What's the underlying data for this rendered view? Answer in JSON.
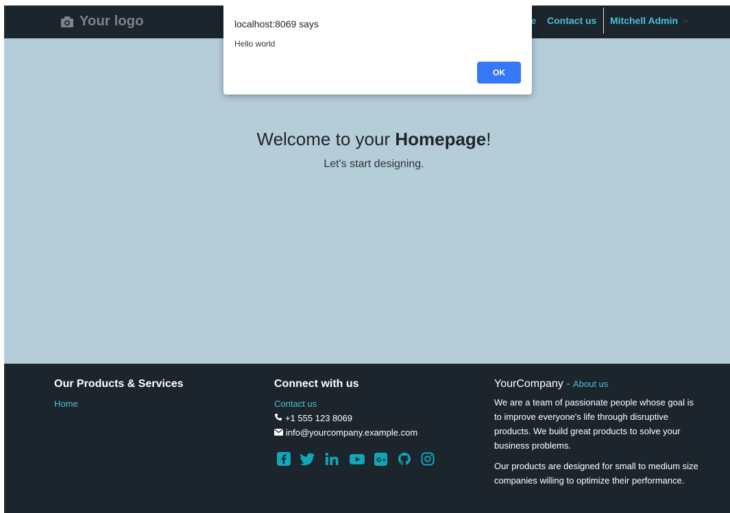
{
  "header": {
    "logo_text": "Your logo",
    "logo_icon": "camera-icon",
    "nav_home_partial": "ne",
    "nav_contact": "Contact us",
    "user_name": "Mitchell Admin"
  },
  "hero": {
    "title_prefix": "Welcome to your ",
    "title_bold": "Homepage",
    "title_suffix": "!",
    "subtitle": "Let's start designing."
  },
  "footer": {
    "products": {
      "heading": "Our Products & Services",
      "link_home": "Home"
    },
    "connect": {
      "heading": "Connect with us",
      "contact_link": "Contact us",
      "phone": "+1 555 123 8069",
      "email": "info@yourcompany.example.com",
      "social_icons": [
        "facebook-icon",
        "twitter-icon",
        "linkedin-icon",
        "youtube-icon",
        "google-plus-icon",
        "github-icon",
        "instagram-icon"
      ]
    },
    "company": {
      "name": "YourCompany",
      "separator": " - ",
      "about_link": "About us",
      "paragraph1": "We are a team of passionate people whose goal is to improve everyone's life through disruptive products. We build great products to solve your business problems.",
      "paragraph2": "Our products are designed for small to medium size companies willing to optimize their performance."
    }
  },
  "dialog": {
    "title": "localhost:8069 says",
    "message": "Hello world",
    "ok_label": "OK"
  },
  "colors": {
    "navbar_bg": "#1c252c",
    "page_bg": "#b5cdd9",
    "accent": "#49c0da",
    "ok_button": "#3478f6"
  }
}
